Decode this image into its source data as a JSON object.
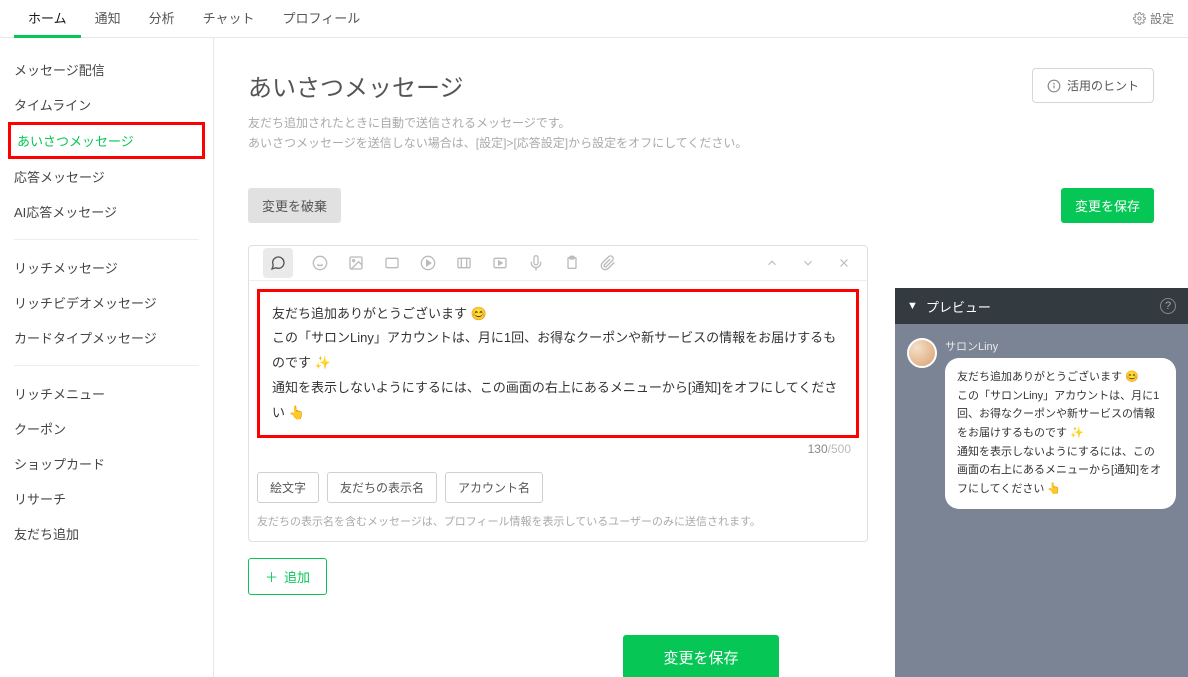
{
  "topnav": {
    "tabs": [
      "ホーム",
      "通知",
      "分析",
      "チャット",
      "プロフィール"
    ],
    "active_index": 0,
    "settings_label": "設定"
  },
  "sidebar": {
    "groups": [
      [
        "メッセージ配信",
        "タイムライン",
        "あいさつメッセージ",
        "応答メッセージ",
        "AI応答メッセージ"
      ],
      [
        "リッチメッセージ",
        "リッチビデオメッセージ",
        "カードタイプメッセージ"
      ],
      [
        "リッチメニュー",
        "クーポン",
        "ショップカード",
        "リサーチ",
        "友だち追加"
      ]
    ],
    "active_label": "あいさつメッセージ"
  },
  "page": {
    "title": "あいさつメッセージ",
    "desc_line1": "友だち追加されたときに自動で送信されるメッセージです。",
    "desc_line2": "あいさつメッセージを送信しない場合は、[設定]>[応答設定]から設定をオフにしてください。",
    "hint_label": "活用のヒント",
    "discard_label": "変更を破棄",
    "save_label": "変更を保存"
  },
  "composer": {
    "text_line1": "友だち追加ありがとうございます 😊",
    "text_line2": "この「サロンLiny」アカウントは、月に1回、お得なクーポンや新サービスの情報をお届けするものです ✨",
    "text_line3": "通知を表示しないようにするには、この画面の右上にあるメニューから[通知]をオフにしてください 👆",
    "count_current": "130",
    "count_max": "500",
    "chips": [
      "絵文字",
      "友だちの表示名",
      "アカウント名"
    ],
    "note": "友だちの表示名を含むメッセージは、プロフィール情報を表示しているユーザーのみに送信されます。",
    "add_label": "追加"
  },
  "save_big_label": "変更を保存",
  "preview": {
    "title": "プレビュー",
    "chat_name": "サロンLiny",
    "bubble_text": "友だち追加ありがとうございます 😊\nこの「サロンLiny」アカウントは、月に1回、お得なクーポンや新サービスの情報をお届けするものです ✨\n通知を表示しないようにするには、この画面の右上にあるメニューから[通知]をオフにしてください 👆"
  }
}
